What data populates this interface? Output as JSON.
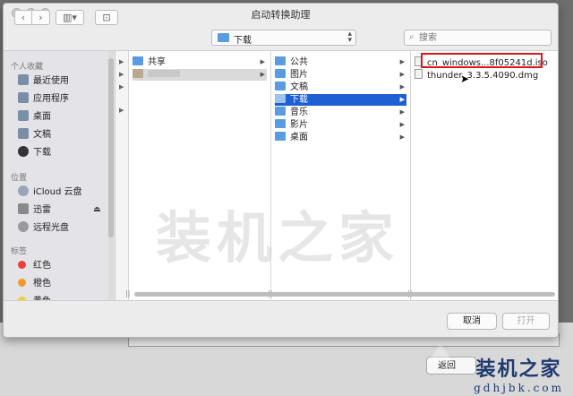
{
  "dialog": {
    "title": "启动转换助理",
    "location": "下载",
    "search_placeholder": "搜索",
    "cancel_label": "取消",
    "open_label": "打开"
  },
  "sidebar": {
    "favorites_header": "个人收藏",
    "favorites": [
      "最近使用",
      "应用程序",
      "桌面",
      "文稿",
      "下载"
    ],
    "devices_header": "位置",
    "devices": [
      "iCloud 云盘",
      "迅雷",
      "远程光盘"
    ],
    "tags_header": "标签",
    "tags": [
      {
        "label": "红色",
        "color": "#e8423b"
      },
      {
        "label": "橙色",
        "color": "#f39a2b"
      },
      {
        "label": "黄色",
        "color": "#f3cf33"
      }
    ]
  },
  "columns": {
    "col1": [
      "共享"
    ],
    "col2": [
      "公共",
      "图片",
      "文稿",
      "下载",
      "音乐",
      "影片",
      "桌面"
    ],
    "col3": [
      "cn_windows...8f05241d.iso",
      "thunder_3.3.5.4090.dmg"
    ]
  },
  "background": {
    "return_label": "返回"
  },
  "watermark": {
    "center": "装机之家",
    "corner": "装机之家",
    "url": "gdhjbk.com"
  }
}
